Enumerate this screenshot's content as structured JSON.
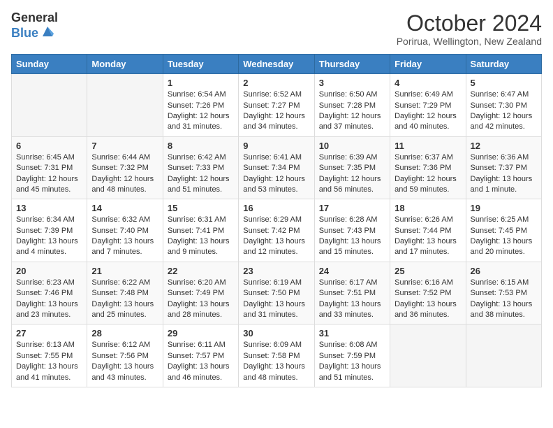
{
  "header": {
    "logo_general": "General",
    "logo_blue": "Blue",
    "month_title": "October 2024",
    "location": "Porirua, Wellington, New Zealand"
  },
  "weekdays": [
    "Sunday",
    "Monday",
    "Tuesday",
    "Wednesday",
    "Thursday",
    "Friday",
    "Saturday"
  ],
  "weeks": [
    [
      {
        "day": "",
        "info": ""
      },
      {
        "day": "",
        "info": ""
      },
      {
        "day": "1",
        "info": "Sunrise: 6:54 AM\nSunset: 7:26 PM\nDaylight: 12 hours and 31 minutes."
      },
      {
        "day": "2",
        "info": "Sunrise: 6:52 AM\nSunset: 7:27 PM\nDaylight: 12 hours and 34 minutes."
      },
      {
        "day": "3",
        "info": "Sunrise: 6:50 AM\nSunset: 7:28 PM\nDaylight: 12 hours and 37 minutes."
      },
      {
        "day": "4",
        "info": "Sunrise: 6:49 AM\nSunset: 7:29 PM\nDaylight: 12 hours and 40 minutes."
      },
      {
        "day": "5",
        "info": "Sunrise: 6:47 AM\nSunset: 7:30 PM\nDaylight: 12 hours and 42 minutes."
      }
    ],
    [
      {
        "day": "6",
        "info": "Sunrise: 6:45 AM\nSunset: 7:31 PM\nDaylight: 12 hours and 45 minutes."
      },
      {
        "day": "7",
        "info": "Sunrise: 6:44 AM\nSunset: 7:32 PM\nDaylight: 12 hours and 48 minutes."
      },
      {
        "day": "8",
        "info": "Sunrise: 6:42 AM\nSunset: 7:33 PM\nDaylight: 12 hours and 51 minutes."
      },
      {
        "day": "9",
        "info": "Sunrise: 6:41 AM\nSunset: 7:34 PM\nDaylight: 12 hours and 53 minutes."
      },
      {
        "day": "10",
        "info": "Sunrise: 6:39 AM\nSunset: 7:35 PM\nDaylight: 12 hours and 56 minutes."
      },
      {
        "day": "11",
        "info": "Sunrise: 6:37 AM\nSunset: 7:36 PM\nDaylight: 12 hours and 59 minutes."
      },
      {
        "day": "12",
        "info": "Sunrise: 6:36 AM\nSunset: 7:37 PM\nDaylight: 13 hours and 1 minute."
      }
    ],
    [
      {
        "day": "13",
        "info": "Sunrise: 6:34 AM\nSunset: 7:39 PM\nDaylight: 13 hours and 4 minutes."
      },
      {
        "day": "14",
        "info": "Sunrise: 6:32 AM\nSunset: 7:40 PM\nDaylight: 13 hours and 7 minutes."
      },
      {
        "day": "15",
        "info": "Sunrise: 6:31 AM\nSunset: 7:41 PM\nDaylight: 13 hours and 9 minutes."
      },
      {
        "day": "16",
        "info": "Sunrise: 6:29 AM\nSunset: 7:42 PM\nDaylight: 13 hours and 12 minutes."
      },
      {
        "day": "17",
        "info": "Sunrise: 6:28 AM\nSunset: 7:43 PM\nDaylight: 13 hours and 15 minutes."
      },
      {
        "day": "18",
        "info": "Sunrise: 6:26 AM\nSunset: 7:44 PM\nDaylight: 13 hours and 17 minutes."
      },
      {
        "day": "19",
        "info": "Sunrise: 6:25 AM\nSunset: 7:45 PM\nDaylight: 13 hours and 20 minutes."
      }
    ],
    [
      {
        "day": "20",
        "info": "Sunrise: 6:23 AM\nSunset: 7:46 PM\nDaylight: 13 hours and 23 minutes."
      },
      {
        "day": "21",
        "info": "Sunrise: 6:22 AM\nSunset: 7:48 PM\nDaylight: 13 hours and 25 minutes."
      },
      {
        "day": "22",
        "info": "Sunrise: 6:20 AM\nSunset: 7:49 PM\nDaylight: 13 hours and 28 minutes."
      },
      {
        "day": "23",
        "info": "Sunrise: 6:19 AM\nSunset: 7:50 PM\nDaylight: 13 hours and 31 minutes."
      },
      {
        "day": "24",
        "info": "Sunrise: 6:17 AM\nSunset: 7:51 PM\nDaylight: 13 hours and 33 minutes."
      },
      {
        "day": "25",
        "info": "Sunrise: 6:16 AM\nSunset: 7:52 PM\nDaylight: 13 hours and 36 minutes."
      },
      {
        "day": "26",
        "info": "Sunrise: 6:15 AM\nSunset: 7:53 PM\nDaylight: 13 hours and 38 minutes."
      }
    ],
    [
      {
        "day": "27",
        "info": "Sunrise: 6:13 AM\nSunset: 7:55 PM\nDaylight: 13 hours and 41 minutes."
      },
      {
        "day": "28",
        "info": "Sunrise: 6:12 AM\nSunset: 7:56 PM\nDaylight: 13 hours and 43 minutes."
      },
      {
        "day": "29",
        "info": "Sunrise: 6:11 AM\nSunset: 7:57 PM\nDaylight: 13 hours and 46 minutes."
      },
      {
        "day": "30",
        "info": "Sunrise: 6:09 AM\nSunset: 7:58 PM\nDaylight: 13 hours and 48 minutes."
      },
      {
        "day": "31",
        "info": "Sunrise: 6:08 AM\nSunset: 7:59 PM\nDaylight: 13 hours and 51 minutes."
      },
      {
        "day": "",
        "info": ""
      },
      {
        "day": "",
        "info": ""
      }
    ]
  ]
}
